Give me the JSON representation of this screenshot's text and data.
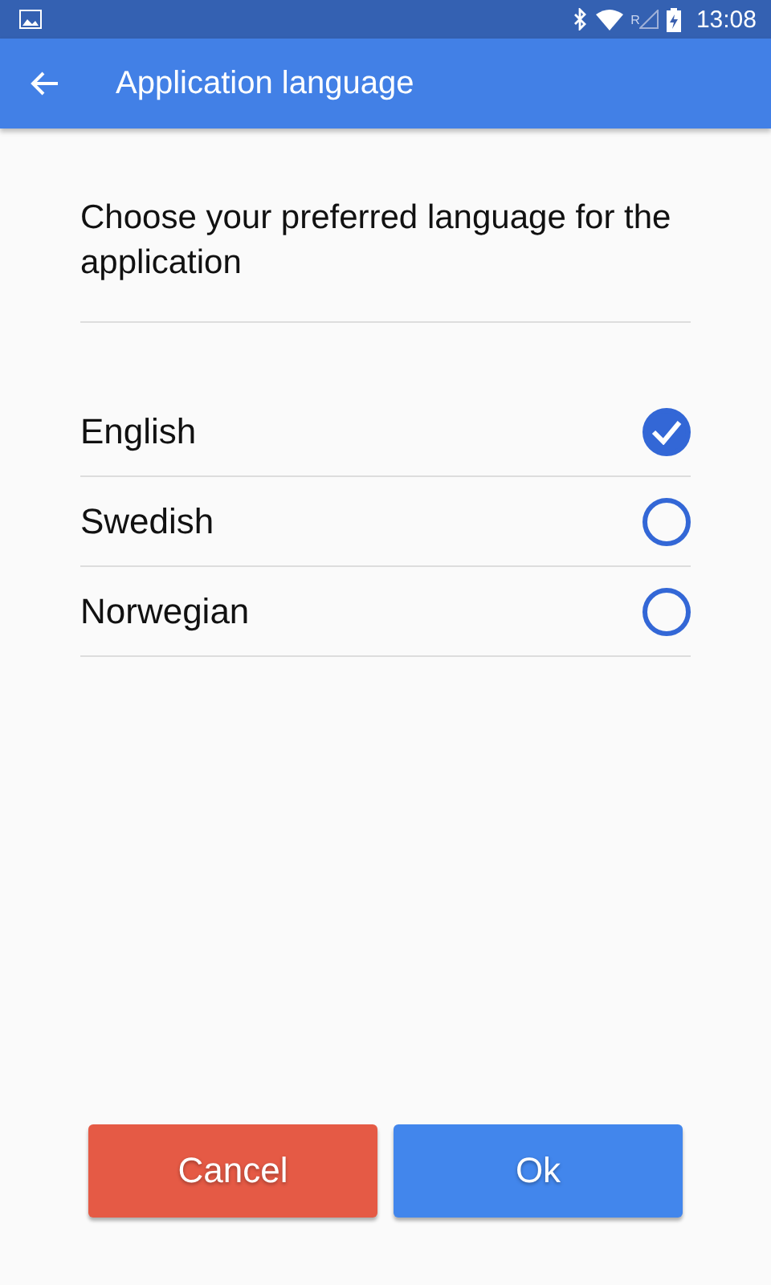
{
  "status_bar": {
    "roaming": "R",
    "time": "13:08"
  },
  "app_bar": {
    "title": "Application language"
  },
  "prompt": "Choose your preferred language for the application",
  "languages": [
    {
      "label": "English",
      "selected": true
    },
    {
      "label": "Swedish",
      "selected": false
    },
    {
      "label": "Norwegian",
      "selected": false
    }
  ],
  "buttons": [
    {
      "label": "Cancel",
      "kind": "cancel"
    },
    {
      "label": "Ok",
      "kind": "ok"
    }
  ]
}
